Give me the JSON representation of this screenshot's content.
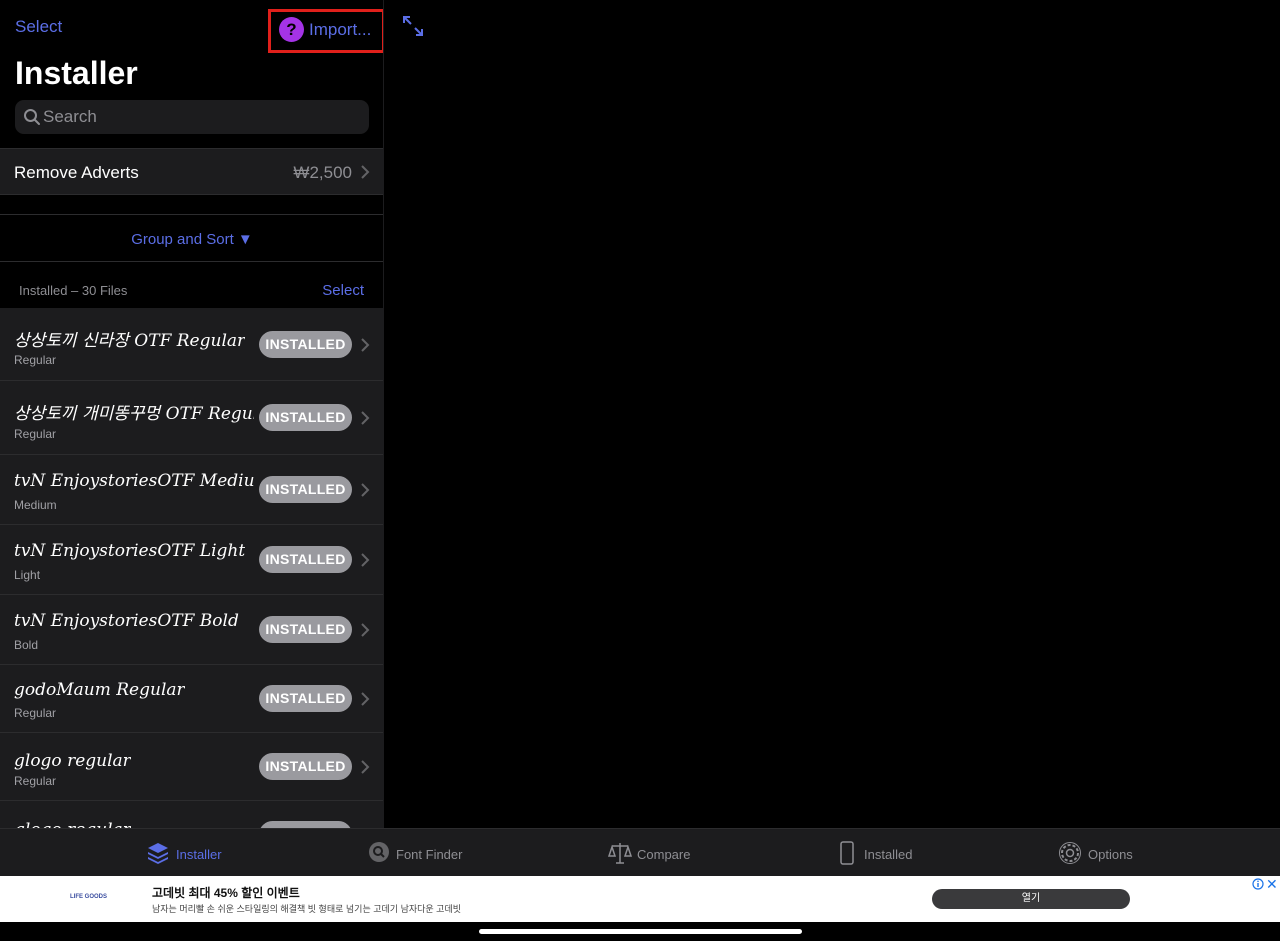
{
  "nav": {
    "select_label": "Select",
    "import_label": "Import...",
    "help_glyph": "?",
    "title": "Installer"
  },
  "search": {
    "placeholder": "Search"
  },
  "advert": {
    "label": "Remove Adverts",
    "price": "₩2,500"
  },
  "group_sort": {
    "label": "Group and Sort ▼"
  },
  "section": {
    "count_label": "Installed – 30 Files",
    "select_label": "Select"
  },
  "fonts": [
    {
      "name": "상상토끼 신라장 OTF Regular",
      "style": "Regular",
      "status": "INSTALLED"
    },
    {
      "name": "상상토끼 개미똥꾸멍 OTF Regular",
      "style": "Regular",
      "status": "INSTALLED"
    },
    {
      "name": "tvN EnjoystoriesOTF Medium",
      "style": "Medium",
      "status": "INSTALLED"
    },
    {
      "name": "tvN EnjoystoriesOTF Light",
      "style": "Light",
      "status": "INSTALLED"
    },
    {
      "name": "tvN EnjoystoriesOTF Bold",
      "style": "Bold",
      "status": "INSTALLED"
    },
    {
      "name": "godoMaum Regular",
      "style": "Regular",
      "status": "INSTALLED"
    },
    {
      "name": "glogo regular",
      "style": "Regular",
      "status": "INSTALLED"
    },
    {
      "name": "glogo regular",
      "style": "",
      "status": ""
    }
  ],
  "tabs": [
    {
      "label": "Installer",
      "icon": "stack-icon",
      "active": true
    },
    {
      "label": "Font Finder",
      "icon": "magnifier-icon",
      "active": false
    },
    {
      "label": "Compare",
      "icon": "scales-icon",
      "active": false
    },
    {
      "label": "Installed",
      "icon": "phone-icon",
      "active": false
    },
    {
      "label": "Options",
      "icon": "gear-icon",
      "active": false
    }
  ],
  "ad": {
    "logo_text": "LIFE GOODS",
    "title": "고데빗 최대 45% 할인 이벤트",
    "description": "남자는 머리빨 손 쉬운 스타일링의 해결책 빗 형태로 넘기는 고데기 남자다운 고데빗",
    "open_label": "열기",
    "close_glyph": "✕"
  },
  "colors": {
    "accent": "#5b6ee6",
    "highlight_border": "#e0201b",
    "help_icon": "#a433e6",
    "badge": "#9a9a9f"
  }
}
